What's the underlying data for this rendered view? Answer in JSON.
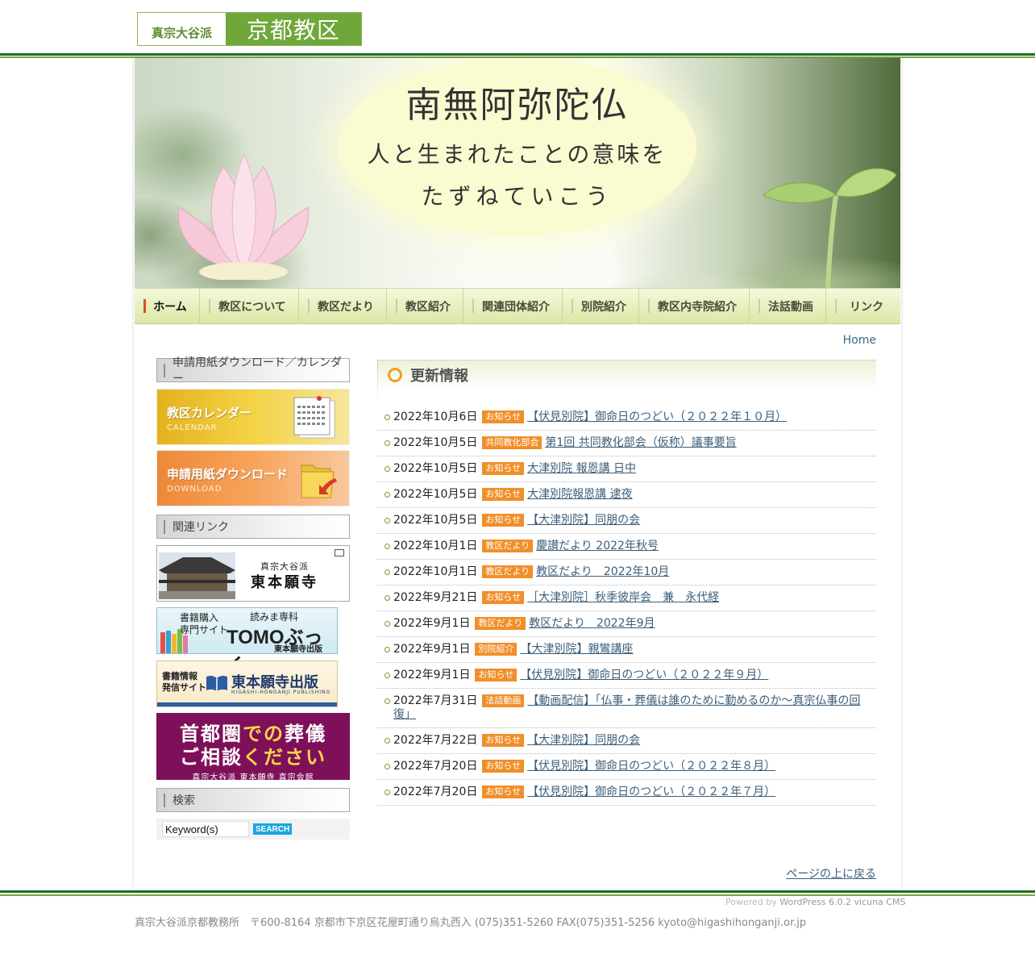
{
  "logo": {
    "sect": "真宗大谷派",
    "diocese": "京都教区"
  },
  "banner": {
    "line1": "南無阿弥陀仏",
    "line2": "人と生まれたことの意味を",
    "line3": "たずねていこう"
  },
  "nav": {
    "items": [
      {
        "label": "ホーム"
      },
      {
        "label": "教区について"
      },
      {
        "label": "教区だより"
      },
      {
        "label": "教区紹介"
      },
      {
        "label": "関連団体紹介"
      },
      {
        "label": "別院紹介"
      },
      {
        "label": "教区内寺院紹介"
      },
      {
        "label": "法話動画"
      },
      {
        "label": "リンク"
      }
    ]
  },
  "breadcrumb": "Home",
  "sidebar": {
    "downloads_heading": "申請用紙ダウンロード／カレンダー",
    "calendar_banner": {
      "title": "教区カレンダー",
      "sub": "CALENDAR"
    },
    "download_banner": {
      "title": "申請用紙ダウンロード",
      "sub": "DOWNLOAD"
    },
    "links_heading": "関連リンク",
    "honganji": {
      "line1": "真宗大谷派",
      "line2": "東本願寺"
    },
    "tomo": {
      "line1": "書籍購入",
      "line2": "専門サイト",
      "tag": "読みま専科",
      "name": "TOMOぶっく",
      "publisher": "東本願寺出版"
    },
    "pub": {
      "line1": "書籍情報",
      "line2": "発信サイト",
      "name": "東本願寺出版",
      "roman": "HIGASHI-HONGANJI PUBLISHING"
    },
    "funeral": {
      "l1a": "首都圏",
      "l1b": "での",
      "l1c": "葬儀",
      "l2a": "ご相談",
      "l2b": "ください",
      "l3": "真宗大谷派 東本願寺 真宗会館"
    },
    "search_heading": "検索",
    "search": {
      "value": "Keyword(s)",
      "button": "SEARCH"
    }
  },
  "news": {
    "title": "更新情報",
    "items": [
      {
        "date": "2022年10月6日",
        "cat": "お知らせ",
        "title": "【伏見別院】御命日のつどい（２０２２年１０月）"
      },
      {
        "date": "2022年10月5日",
        "cat": "共同教化部会",
        "title": "第1回 共同教化部会（仮称）議事要旨"
      },
      {
        "date": "2022年10月5日",
        "cat": "お知らせ",
        "title": "大津別院 報恩講 日中"
      },
      {
        "date": "2022年10月5日",
        "cat": "お知らせ",
        "title": "大津別院報恩講 逮夜"
      },
      {
        "date": "2022年10月5日",
        "cat": "お知らせ",
        "title": "【大津別院】同朋の会"
      },
      {
        "date": "2022年10月1日",
        "cat": "教区だより",
        "title": "慶讃だより 2022年秋号"
      },
      {
        "date": "2022年10月1日",
        "cat": "教区だより",
        "title": "教区だより　2022年10月"
      },
      {
        "date": "2022年9月21日",
        "cat": "お知らせ",
        "title": "［大津別院］秋季彼岸会　兼　永代経"
      },
      {
        "date": "2022年9月1日",
        "cat": "教区だより",
        "title": "教区だより　2022年9月"
      },
      {
        "date": "2022年9月1日",
        "cat": "別院紹介",
        "title": "【大津別院】親鸞講座"
      },
      {
        "date": "2022年9月1日",
        "cat": "お知らせ",
        "title": "【伏見別院】御命日のつどい（２０２２年９月）"
      },
      {
        "date": "2022年7月31日",
        "cat": "法話動画",
        "title": "【動画配信】「仏事・葬儀は誰のために勤めるのか〜真宗仏事の回復」"
      },
      {
        "date": "2022年7月22日",
        "cat": "お知らせ",
        "title": "【大津別院】同朋の会"
      },
      {
        "date": "2022年7月20日",
        "cat": "お知らせ",
        "title": "【伏見別院】御命日のつどい（２０２２年８月）"
      },
      {
        "date": "2022年7月20日",
        "cat": "お知らせ",
        "title": "【伏見別院】御命日のつどい（２０２２年７月）"
      }
    ]
  },
  "pagetop": "ページの上に戻る",
  "footer": {
    "powered_label": "Powered by",
    "wp": "WordPress 6.0.2",
    "cms": "vicuna CMS",
    "address": "真宗大谷派京都教務所　〒600-8164 京都市下京区花屋町通り烏丸西入 (075)351-5260 FAX(075)351-5256 kyoto@higashihonganji.or.jp"
  },
  "colors": {
    "brand_green": "#6fa73a",
    "dark_green": "#1e6c2c",
    "category_orange": "#f08f2a",
    "link_blue": "#3b5e7a",
    "funeral_purple": "#7e1059"
  }
}
